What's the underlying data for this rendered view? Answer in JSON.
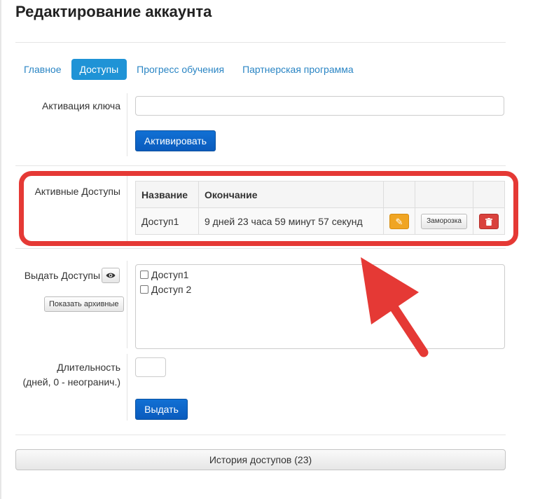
{
  "page_title": "Редактирование аккаунта",
  "tabs": [
    {
      "label": "Главное",
      "active": false
    },
    {
      "label": "Доступы",
      "active": true
    },
    {
      "label": "Прогресс обучения",
      "active": false
    },
    {
      "label": "Партнерская программа",
      "active": false
    }
  ],
  "key_activation": {
    "label": "Активация ключа",
    "value": "",
    "button_label": "Активировать"
  },
  "active_access": {
    "label": "Активные Доступы",
    "columns": [
      "Название",
      "Окончание",
      "",
      "",
      ""
    ],
    "rows": [
      {
        "name": "Доступ1",
        "ending": "9 дней 23 часа 59 минут 57 секунд",
        "freeze_label": "Заморозка",
        "edit_icon": "pencil-icon",
        "delete_icon": "trash-icon"
      }
    ]
  },
  "grant_access": {
    "label": "Выдать Доступы",
    "eye_icon": "eye-icon",
    "show_archived_label": "Показать архивные",
    "options": [
      {
        "label": "Доступ1",
        "checked": false
      },
      {
        "label": "Доступ 2",
        "checked": false
      }
    ]
  },
  "duration": {
    "label_line1": "Длительность",
    "label_line2": "(дней, 0 - неогранич.)",
    "value": ""
  },
  "grant_button_label": "Выдать",
  "history_button_label": "История доступов (23)",
  "colors": {
    "accent": "#1f93d6",
    "primary_button": "#0a5bbd",
    "highlight": "#e53935",
    "edit": "#f0a523",
    "delete": "#d9423d"
  }
}
